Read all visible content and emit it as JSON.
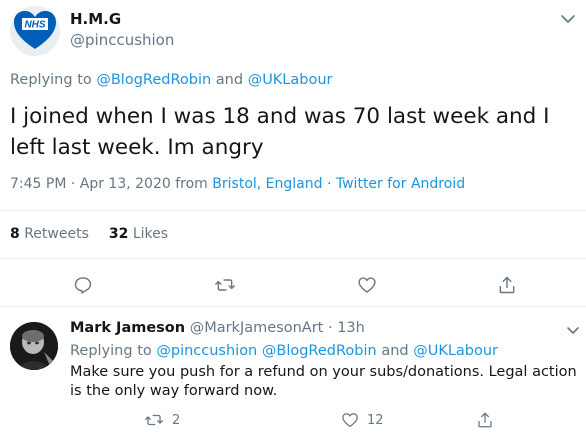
{
  "tweet": {
    "avatar_logo": "NHS",
    "author_name": "H.M.G",
    "author_handle": "@pinccushion",
    "replying_prefix": "Replying to",
    "replying_user1": "@BlogRedRobin",
    "replying_and": "and",
    "replying_user2": "@UKLabour",
    "text": "I joined when I was 18 and was 70 last week and I left last week.  Im angry",
    "time": "7:45 PM · Apr 13, 2020",
    "from_word": "from",
    "location": "Bristol, England",
    "separator": "·",
    "client": "Twitter for Android",
    "retweets_count": "8",
    "retweets_label": "Retweets",
    "likes_count": "32",
    "likes_label": "Likes",
    "icons": [
      "chevron-down-icon",
      "reply-icon",
      "retweet-icon",
      "like-icon",
      "share-icon"
    ]
  },
  "reply": {
    "author_name": "Mark Jameson",
    "author_handle": "@MarkJamesonArt",
    "separator": "·",
    "age": "13h",
    "replying_prefix": "Replying to",
    "replying_user1": "@pinccushion",
    "replying_user2": "@BlogRedRobin",
    "replying_and": "and",
    "replying_user3": "@UKLabour",
    "text": "Make sure you push for a refund on your subs/donations. Legal action is the only way forward now.",
    "retweet_count": "2",
    "like_count": "12"
  },
  "colors": {
    "link": "#1b95e0",
    "muted": "#657786",
    "text": "#14171a",
    "divider": "#e6ecf0",
    "nhs_blue": "#005eb8"
  }
}
